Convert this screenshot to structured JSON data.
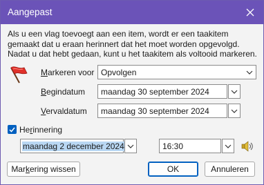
{
  "window": {
    "title": "Aangepast"
  },
  "info_text": "Als u een vlag toevoegt aan een item, wordt er een taakitem gemaakt dat u eraan herinnert dat het moet worden opgevolgd. Nadat u dat hebt gedaan, kunt u het taakitem als voltooid markeren.",
  "flag_icon": "red-flag-icon",
  "fields": {
    "mark_label_m": "M",
    "mark_label_rest": "arkeren voor",
    "mark_value": "Opvolgen",
    "start_label_b": "B",
    "start_label_rest": "egindatum",
    "start_value": "maandag 30 september 2024",
    "due_label_v": "V",
    "due_label_rest": "ervaldatum",
    "due_value": "maandag 30 september 2024"
  },
  "reminder": {
    "checked": true,
    "label_pre": "He",
    "label_r": "r",
    "label_post": "innering",
    "date_value": "maandag 2 december 2024",
    "time_value": "16:30",
    "sound_icon": "speaker-icon"
  },
  "buttons": {
    "clear_pre": "Mar",
    "clear_k": "k",
    "clear_post": "ering wissen",
    "ok": "OK",
    "cancel": "Annuleren"
  },
  "colors": {
    "titlebar": "#6b53b8",
    "accent": "#0060c0",
    "selection": "#b9d7f3"
  }
}
